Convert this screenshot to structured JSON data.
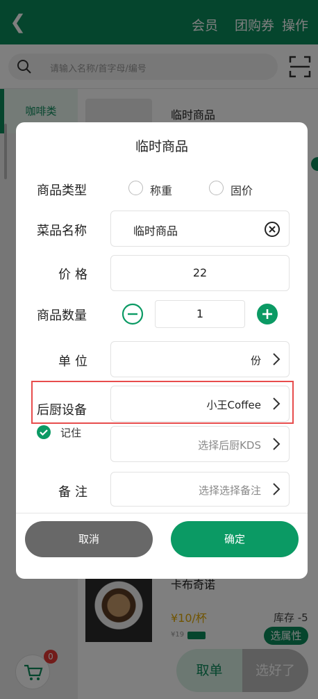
{
  "topbar": {
    "back_icon": "chevron-left-icon",
    "menu_member": "会员",
    "menu_coupon": "团购券",
    "menu_actions": "操作"
  },
  "search": {
    "placeholder": "请输入名称/首字母/编号",
    "search_icon": "search-icon",
    "scan_icon": "scan-icon"
  },
  "sidebar": {
    "active_category": "咖啡类"
  },
  "list": {
    "top_item_title": "临时商品",
    "coffee_title": "卡布奇诺",
    "price": "¥10/杯",
    "member_price": "¥19",
    "stock": "库存 -5",
    "attr_button": "选属性"
  },
  "cart": {
    "badge": "0"
  },
  "bottom": {
    "take_order": "取单",
    "done": "选好了"
  },
  "dialog": {
    "title": "临时商品",
    "type_label": "商品类型",
    "type_options": [
      "称重",
      "固价"
    ],
    "name_label": "菜品名称",
    "name_value": "临时商品",
    "price_label": "价格",
    "price_value": "22",
    "qty_label": "商品数量",
    "qty_value": "1",
    "unit_label": "单位",
    "unit_value": "份",
    "kitchen_label": "后厨设备",
    "kitchen_value": "小王Coffee",
    "kds_placeholder": "选择后厨KDS",
    "remember_label": "记住",
    "remark_label": "备注",
    "remark_placeholder": "选择选择备注",
    "cancel_label": "取消",
    "ok_label": "确定"
  },
  "colors": {
    "brand_green": "#0b8a5a",
    "button_green": "#0b9a64",
    "highlight_red": "#e74c4c",
    "cancel_gray": "#686868"
  }
}
